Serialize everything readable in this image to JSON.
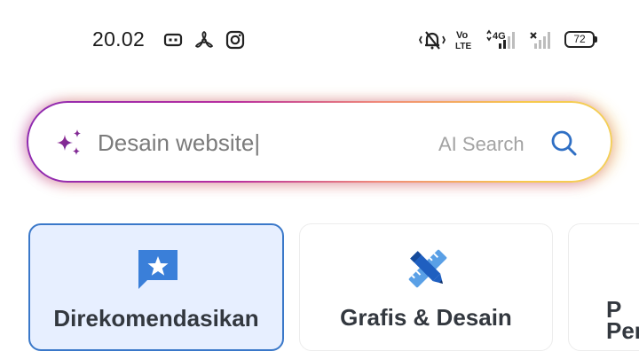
{
  "status_bar": {
    "time": "20.02",
    "battery_level": "72",
    "network_label": "4G",
    "volte_label": "Vo LTE",
    "icons": [
      "screen-record-icon",
      "fan-icon",
      "instagram-icon",
      "mute-icon",
      "volte-icon",
      "signal-icon",
      "no-signal-icon",
      "battery-icon"
    ]
  },
  "search": {
    "value": "Desain website|",
    "ai_label": "AI Search",
    "colors": {
      "gradient_start": "#8f2bb0",
      "gradient_mid": "#f08a7a",
      "gradient_end": "#f7c94c",
      "search_icon": "#2f6fc4",
      "sparkle": "#8a2b8c"
    }
  },
  "categories": [
    {
      "label": "Direkomendasikan",
      "icon": "star-message-icon",
      "active": true
    },
    {
      "label": "Grafis & Desain",
      "icon": "pencil-ruler-icon",
      "active": false
    },
    {
      "label": "P\nPer",
      "icon": "",
      "active": false
    }
  ],
  "colors": {
    "active_card_bg": "#e7efff",
    "active_card_border": "#3a78c9",
    "accent_blue": "#3a78c9"
  }
}
